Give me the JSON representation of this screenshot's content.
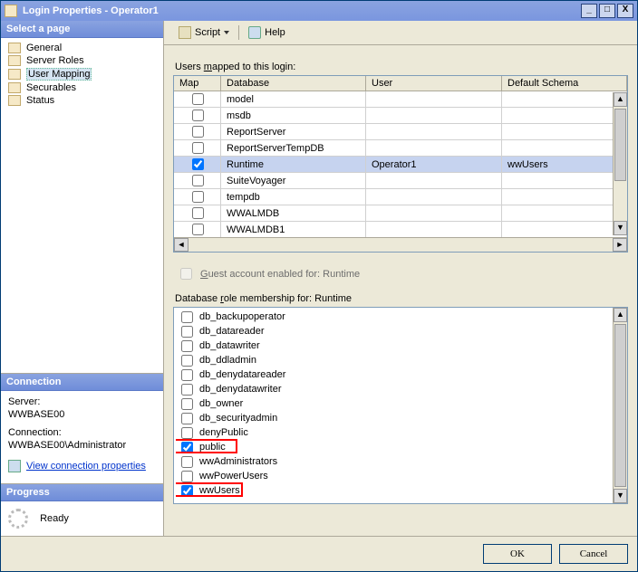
{
  "window": {
    "title": "Login Properties - Operator1",
    "minimize": "_",
    "maximize": "□",
    "close": "X"
  },
  "toolbar": {
    "script_label": "Script",
    "help_label": "Help"
  },
  "left": {
    "select_page": "Select a page",
    "nav": [
      {
        "label": "General"
      },
      {
        "label": "Server Roles"
      },
      {
        "label": "User Mapping"
      },
      {
        "label": "Securables"
      },
      {
        "label": "Status"
      }
    ],
    "connection_head": "Connection",
    "server_label": "Server:",
    "server_value": "WWBASE00",
    "conn_label": "Connection:",
    "conn_value": "WWBASE00\\Administrator",
    "view_conn": "View connection properties",
    "progress_head": "Progress",
    "progress_value": "Ready"
  },
  "main": {
    "users_mapped_label": "Users mapped to this login:",
    "columns": {
      "map": "Map",
      "database": "Database",
      "user": "User",
      "schema": "Default Schema"
    },
    "rows": [
      {
        "checked": false,
        "database": "model",
        "user": "",
        "schema": ""
      },
      {
        "checked": false,
        "database": "msdb",
        "user": "",
        "schema": ""
      },
      {
        "checked": false,
        "database": "ReportServer",
        "user": "",
        "schema": ""
      },
      {
        "checked": false,
        "database": "ReportServerTempDB",
        "user": "",
        "schema": ""
      },
      {
        "checked": true,
        "database": "Runtime",
        "user": "Operator1",
        "schema": "wwUsers",
        "selected": true
      },
      {
        "checked": false,
        "database": "SuiteVoyager",
        "user": "",
        "schema": ""
      },
      {
        "checked": false,
        "database": "tempdb",
        "user": "",
        "schema": ""
      },
      {
        "checked": false,
        "database": "WWALMDB",
        "user": "",
        "schema": ""
      },
      {
        "checked": false,
        "database": "WWALMDB1",
        "user": "",
        "schema": ""
      }
    ],
    "guest_label": "Guest account enabled for: Runtime",
    "roles_label": "Database role membership for: Runtime",
    "roles": [
      {
        "checked": false,
        "label": "db_backupoperator"
      },
      {
        "checked": false,
        "label": "db_datareader"
      },
      {
        "checked": false,
        "label": "db_datawriter"
      },
      {
        "checked": false,
        "label": "db_ddladmin"
      },
      {
        "checked": false,
        "label": "db_denydatareader"
      },
      {
        "checked": false,
        "label": "db_denydatawriter"
      },
      {
        "checked": false,
        "label": "db_owner"
      },
      {
        "checked": false,
        "label": "db_securityadmin"
      },
      {
        "checked": false,
        "label": "denyPublic"
      },
      {
        "checked": true,
        "label": "public",
        "highlight": true
      },
      {
        "checked": false,
        "label": "wwAdministrators"
      },
      {
        "checked": false,
        "label": "wwPowerUsers"
      },
      {
        "checked": true,
        "label": "wwUsers",
        "highlight": true
      }
    ]
  },
  "footer": {
    "ok": "OK",
    "cancel": "Cancel"
  }
}
